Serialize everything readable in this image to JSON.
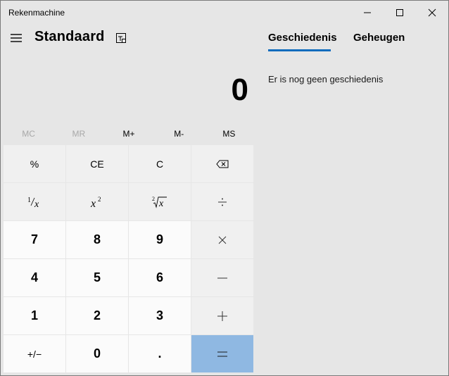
{
  "window": {
    "title": "Rekenmachine"
  },
  "header": {
    "mode_title": "Standaard"
  },
  "display": {
    "value": "0"
  },
  "memory": {
    "mc": "MC",
    "mr": "MR",
    "mplus": "M+",
    "mminus": "M-",
    "ms": "MS"
  },
  "keys": {
    "percent": "%",
    "ce": "CE",
    "c": "C",
    "seven": "7",
    "eight": "8",
    "nine": "9",
    "four": "4",
    "five": "5",
    "six": "6",
    "one": "1",
    "two": "2",
    "three": "3",
    "zero": "0",
    "decimal": ".",
    "negate": "+/−"
  },
  "panel": {
    "tab_history": "Geschiedenis",
    "tab_memory": "Geheugen",
    "history_empty": "Er is nog geen geschiedenis"
  },
  "colors": {
    "accent": "#0f6cbd",
    "equals_key": "#8fb8e2",
    "background": "#e6e6e6"
  }
}
